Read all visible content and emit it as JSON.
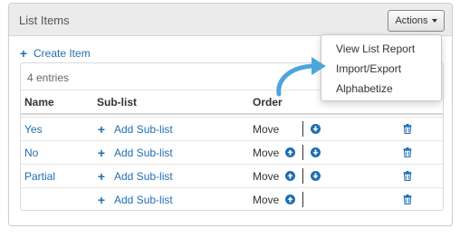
{
  "panel": {
    "title": "List Items",
    "actions_label": "Actions"
  },
  "toolbar": {
    "create_label": "Create Item"
  },
  "table": {
    "entries": "4 entries",
    "columns": [
      "Name",
      "Sub-list",
      "Order"
    ],
    "add_sublist_label": "Add Sub-list",
    "move_label": "Move",
    "rows": [
      {
        "name": "Yes",
        "can_move_up": false,
        "can_move_down": true
      },
      {
        "name": "No",
        "can_move_up": true,
        "can_move_down": true
      },
      {
        "name": "Partial",
        "can_move_up": true,
        "can_move_down": true
      },
      {
        "name": "",
        "can_move_up": true,
        "can_move_down": false
      }
    ]
  },
  "actions_menu": {
    "items": [
      "View List Report",
      "Import/Export",
      "Alphabetize"
    ]
  },
  "colors": {
    "link": "#1f6fb2",
    "header_bg": "#ebebeb",
    "arrow": "#4da6dc"
  },
  "icons": {
    "create": "plus-icon",
    "add_sublist": "plus-icon",
    "move_up": "arrow-up-circle-icon",
    "move_down": "arrow-down-circle-icon",
    "delete": "trash-icon",
    "actions": "caret-down-icon",
    "annotation": "curved-arrow-icon"
  }
}
